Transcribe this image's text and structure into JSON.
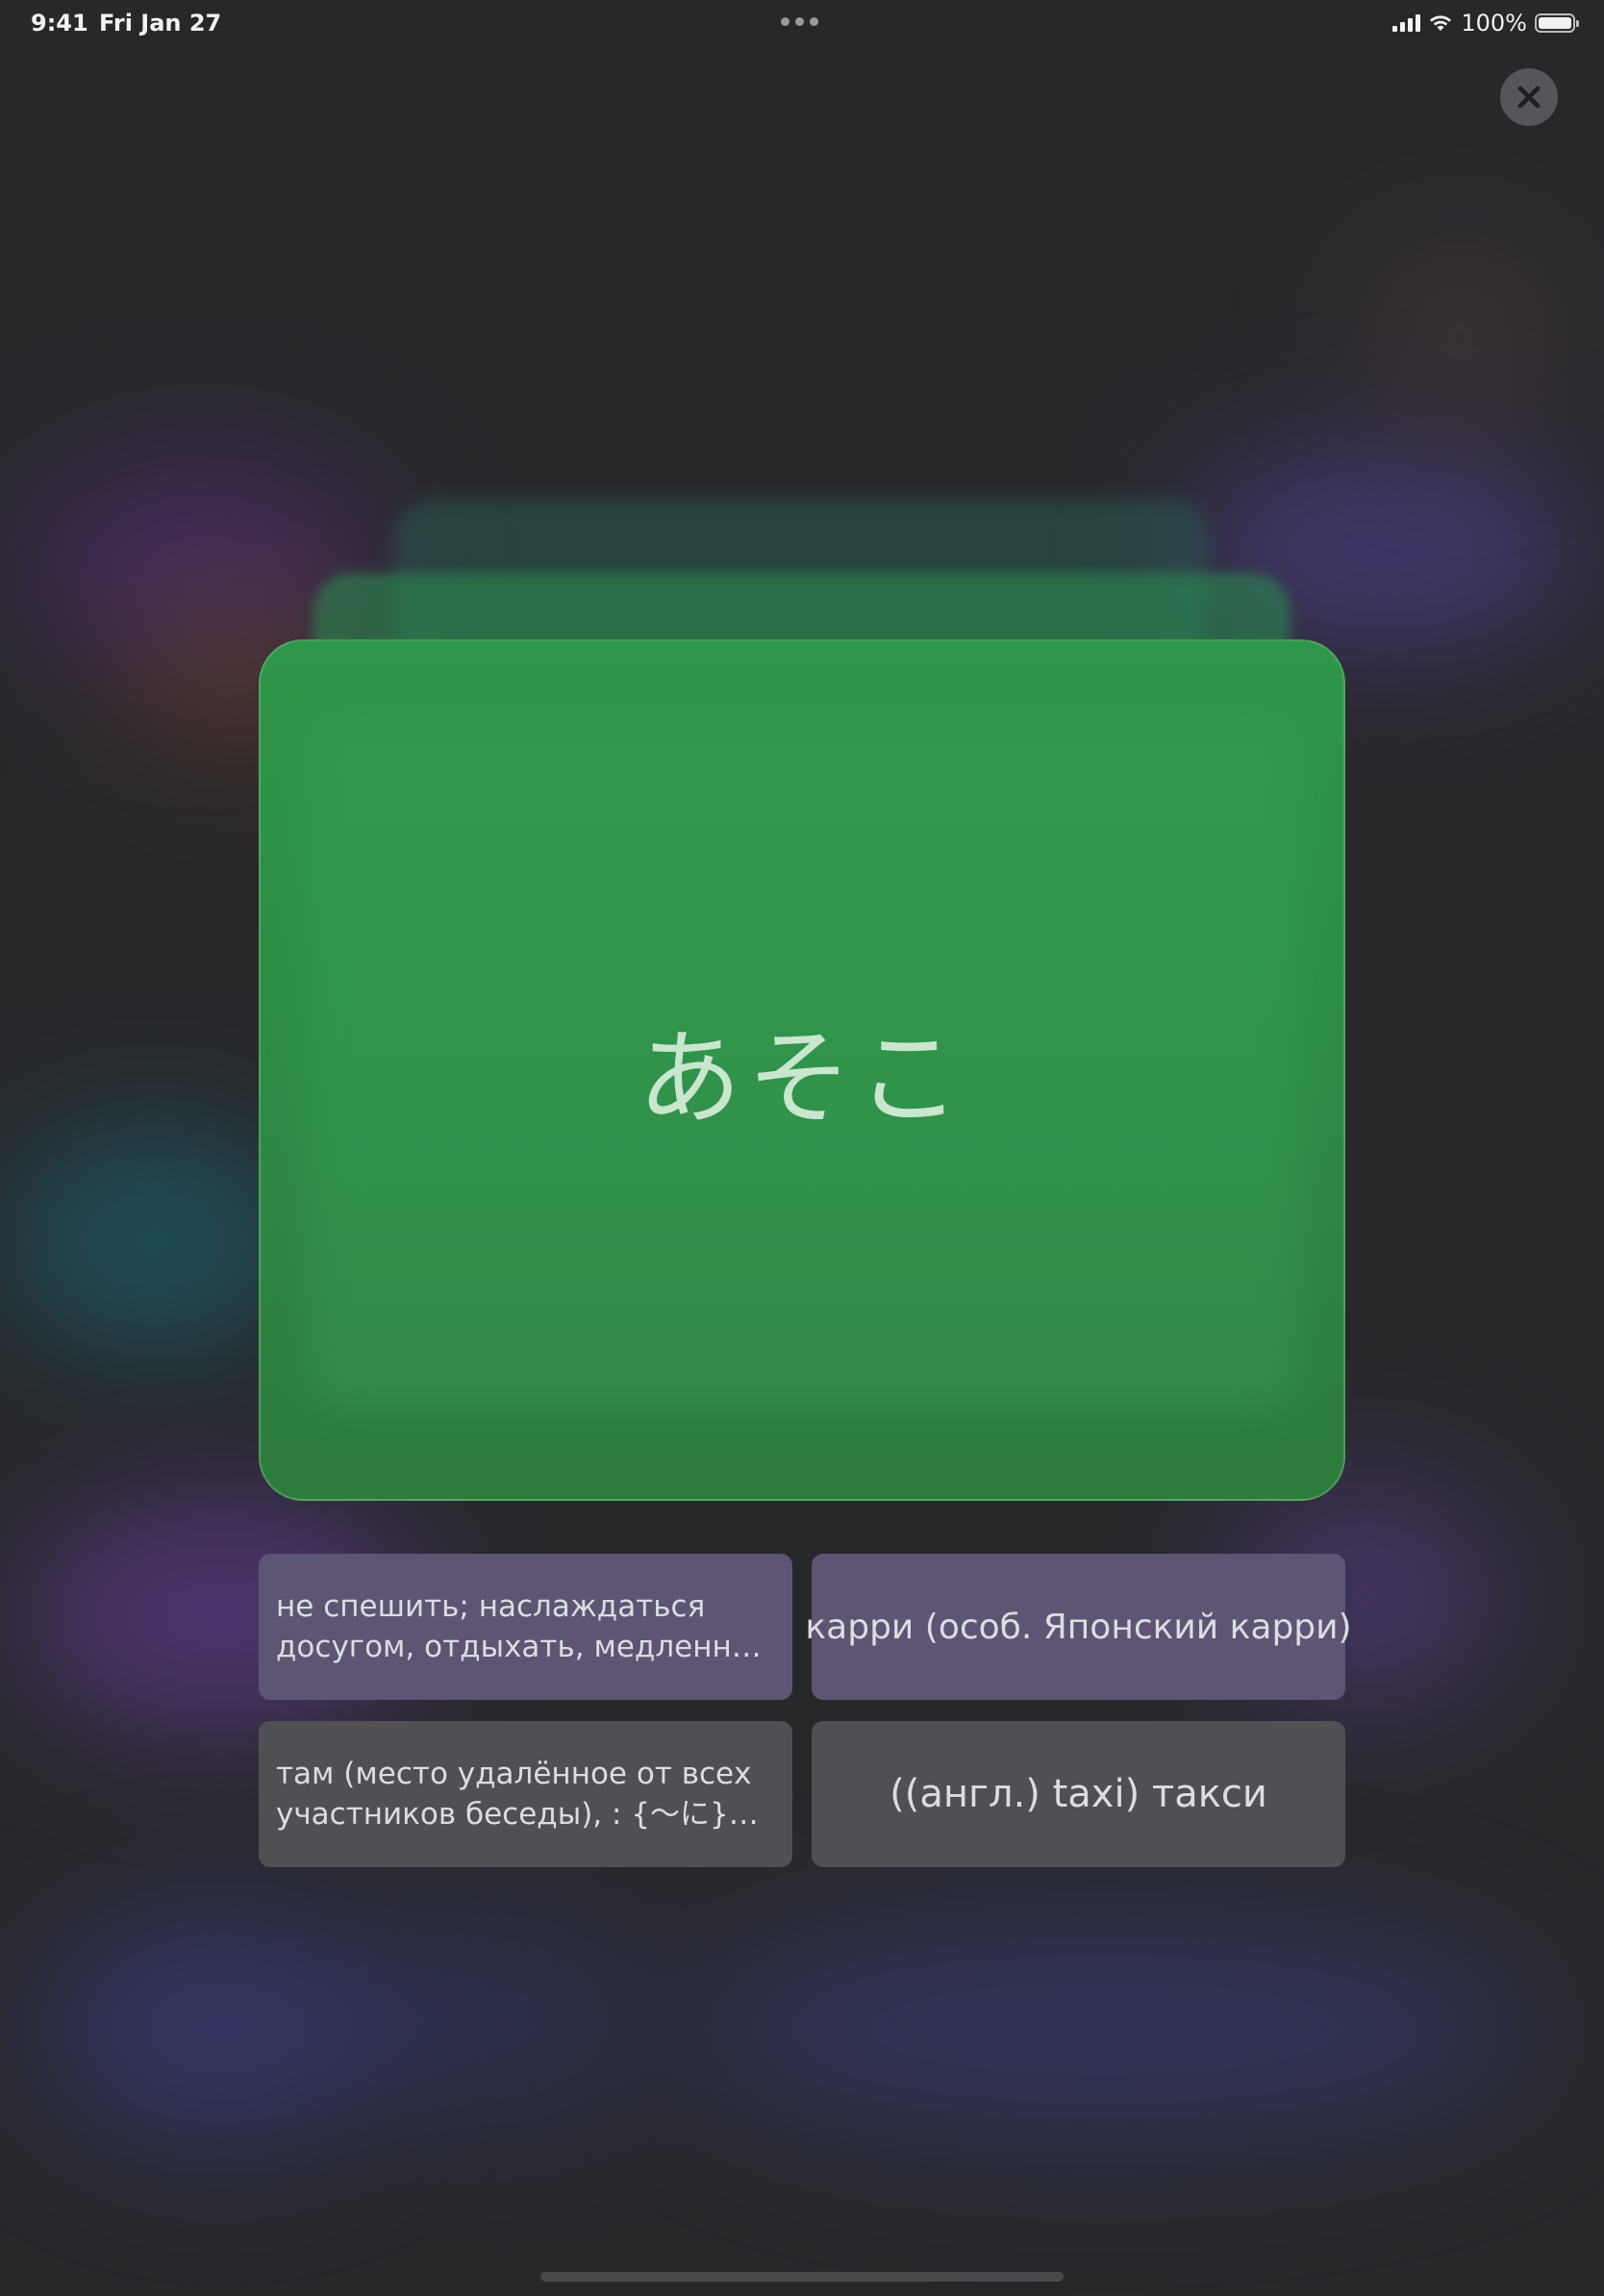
{
  "status_bar": {
    "time": "9:41",
    "date": "Fri Jan 27",
    "battery": "100%"
  },
  "close_button": {
    "icon": "close-icon"
  },
  "flashcard": {
    "word": "あそこ",
    "color": "#2e8a44"
  },
  "options": [
    {
      "text": "не спешить; наслаждаться досугом, отдыхать, медленно, н…"
    },
    {
      "text": "карри (особ. Японский карри)"
    },
    {
      "text": "там (место удалённое от всех участников беседы), : {〜に} (ус…"
    },
    {
      "text": "((англ.) taxi) такси"
    }
  ]
}
